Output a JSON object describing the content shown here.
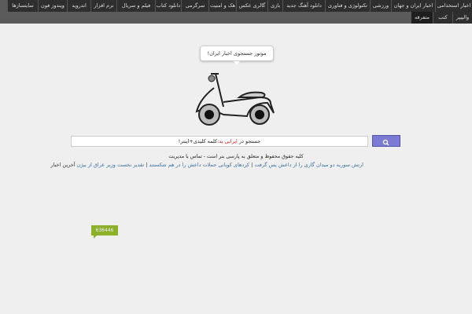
{
  "nav": {
    "row1": [
      "اخبار استخدامی",
      "اخبار ایران و جهان",
      "ورزشی",
      "تکنولوژی و فناوری",
      "دانلود آهنگ جدید",
      "بازی",
      "گالری عکس",
      "هک و امنیت",
      "سرگرمی",
      "دانلود کتاب",
      "فیلم و سریال",
      "نرم افزار",
      "اندروید",
      "ویندوز فون",
      "سایتسازها"
    ],
    "row2": [
      "والپیپر",
      "کتب",
      "متفرقه"
    ]
  },
  "bubble": "موتور جستجوی اخبار ایران!",
  "search": {
    "prefix": "جستجو در ",
    "site": "ایرانی پد",
    "suffix": ":کلمه کلیدی+اینتر!"
  },
  "footer": {
    "copyright": "کلیه حقوق محفوظ و متعلق به پارسی بنر است - تماس با مدیریت"
  },
  "news": {
    "label": "آخرین اخبار",
    "items": [
      "ارتش سوریه دو میدان گازی را از داعش پس گرفت",
      "کردهای کوبانی حملات داعش را در هم شکستند",
      "تقدیر نخست وزیر عراق از بیژن"
    ]
  },
  "counter": "636446",
  "colors": {
    "accent": "#7b7bd6",
    "badge": "#8cb02a"
  }
}
